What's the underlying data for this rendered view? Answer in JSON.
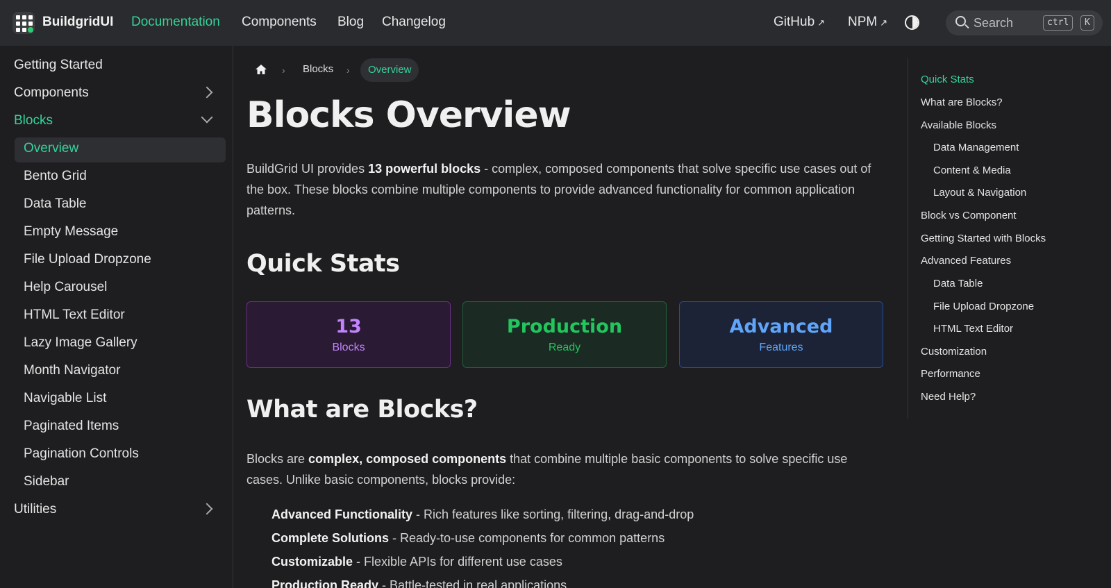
{
  "header": {
    "brand": "BuildgridUI",
    "nav": [
      "Documentation",
      "Components",
      "Blog",
      "Changelog"
    ],
    "github_label": "GitHub",
    "npm_label": "NPM",
    "search_placeholder": "Search",
    "search_kbd": [
      "ctrl",
      "K"
    ],
    "accent_color": "#34d399"
  },
  "sidebar": {
    "getting_started": "Getting Started",
    "components": "Components",
    "blocks": "Blocks",
    "block_items": [
      "Overview",
      "Bento Grid",
      "Data Table",
      "Empty Message",
      "File Upload Dropzone",
      "Help Carousel",
      "HTML Text Editor",
      "Lazy Image Gallery",
      "Month Navigator",
      "Navigable List",
      "Paginated Items",
      "Pagination Controls",
      "Sidebar"
    ],
    "utilities": "Utilities"
  },
  "breadcrumb": {
    "home_icon": "home-icon",
    "blocks": "Blocks",
    "current": "Overview"
  },
  "main": {
    "title": "Blocks Overview",
    "intro_a": "BuildGrid UI provides ",
    "intro_bold": "13 powerful blocks",
    "intro_b": " - complex, composed components that solve specific use cases out of the box. These blocks combine multiple components to provide advanced functionality for common application patterns.",
    "quick_stats_heading": "Quick Stats",
    "stats": [
      {
        "value": "13",
        "label": "Blocks",
        "color": "#c084fc"
      },
      {
        "value": "Production",
        "label": "Ready",
        "color": "#22c55e"
      },
      {
        "value": "Advanced",
        "label": "Features",
        "color": "#60a5fa"
      }
    ],
    "what_heading": "What are Blocks?",
    "what_a": "Blocks are ",
    "what_bold": "complex, composed components",
    "what_b": " that combine multiple basic components to solve specific use cases. Unlike basic components, blocks provide:",
    "features": [
      {
        "title": "Advanced Functionality",
        "desc": " - Rich features like sorting, filtering, drag-and-drop"
      },
      {
        "title": "Complete Solutions",
        "desc": " - Ready-to-use components for common patterns"
      },
      {
        "title": "Customizable",
        "desc": " - Flexible APIs for different use cases"
      },
      {
        "title": "Production Ready",
        "desc": " - Battle-tested in real applications"
      }
    ]
  },
  "toc": [
    "Quick Stats",
    "What are Blocks?",
    "Available Blocks",
    "Data Management",
    "Content & Media",
    "Layout & Navigation",
    "Block vs Component",
    "Getting Started with Blocks",
    "Advanced Features",
    "Data Table",
    "File Upload Dropzone",
    "HTML Text Editor",
    "Customization",
    "Performance",
    "Need Help?"
  ]
}
